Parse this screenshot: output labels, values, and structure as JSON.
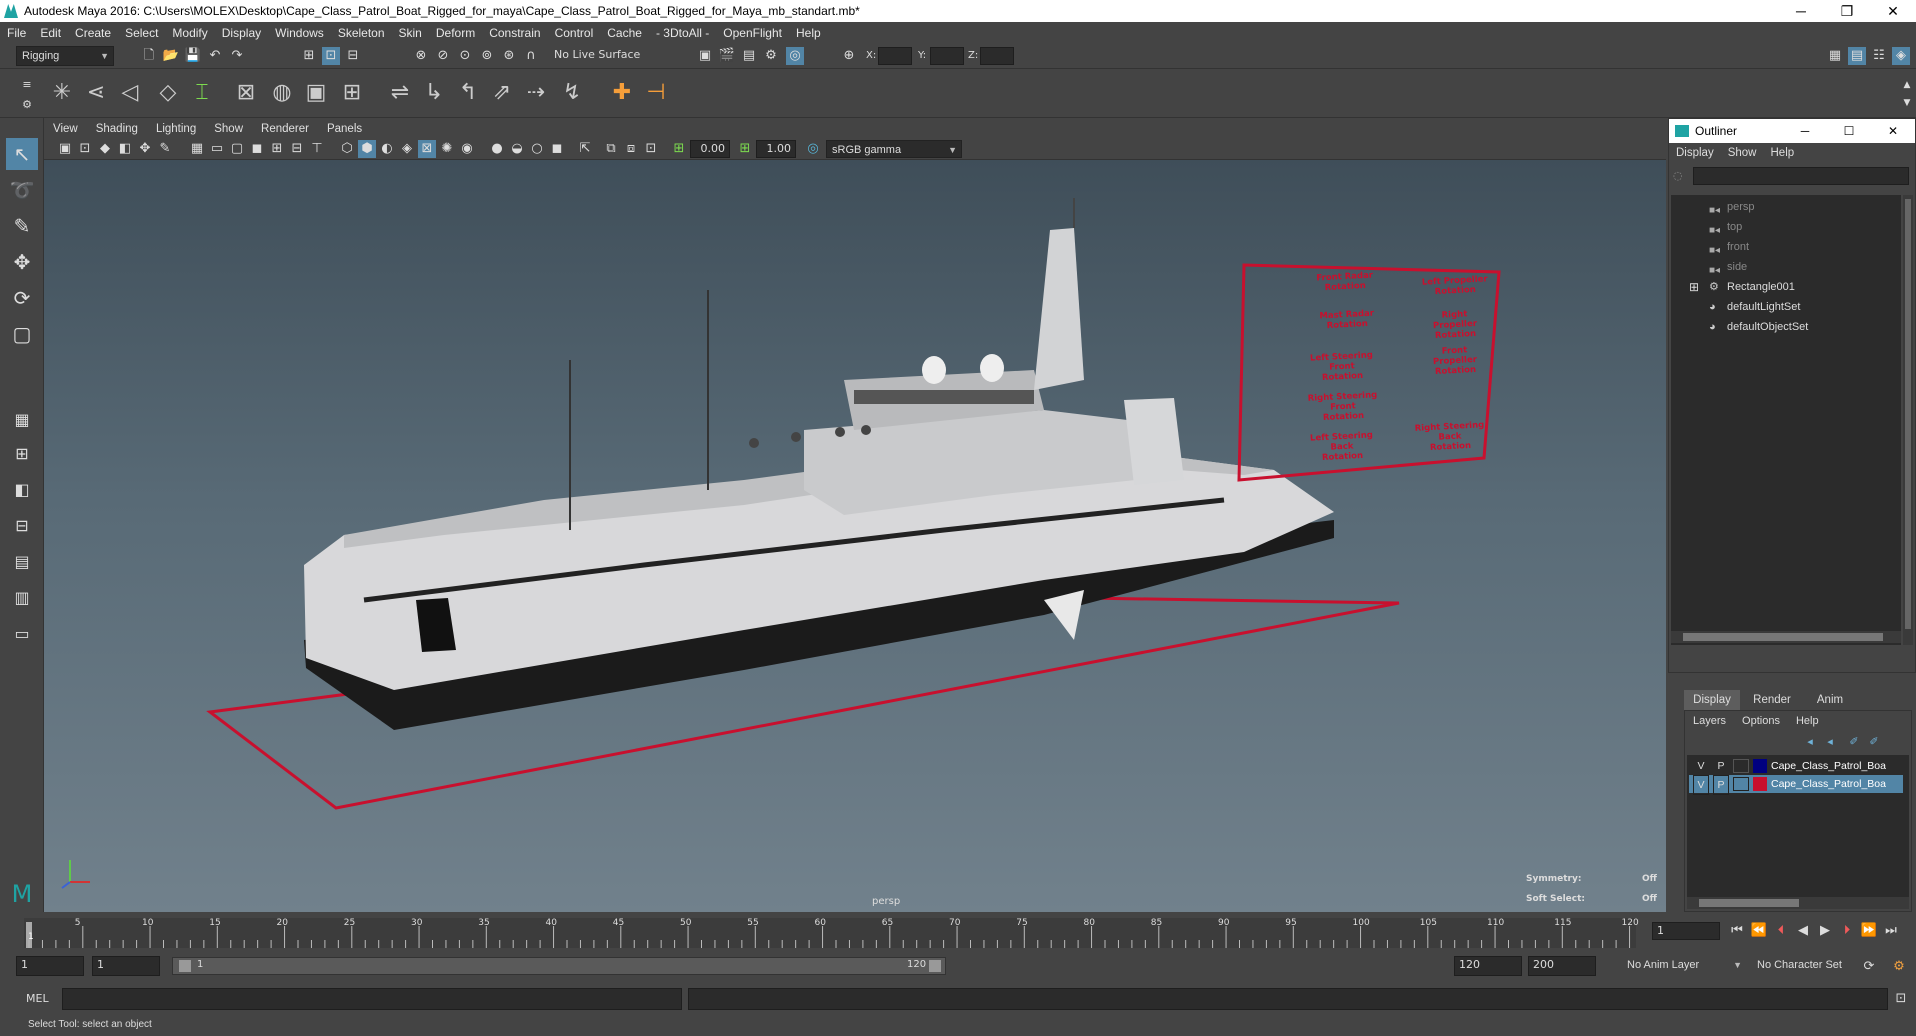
{
  "window": {
    "title": "Autodesk Maya 2016: C:\\Users\\MOLEX\\Desktop\\Cape_Class_Patrol_Boat_Rigged_for_maya\\Cape_Class_Patrol_Boat_Rigged_for_Maya_mb_standart.mb*",
    "min": "─",
    "max": "❐",
    "close": "✕"
  },
  "menubar": [
    "File",
    "Edit",
    "Create",
    "Select",
    "Modify",
    "Display",
    "Windows",
    "Skeleton",
    "Skin",
    "Deform",
    "Constrain",
    "Control",
    "Cache",
    "- 3DtoAll -",
    "OpenFlight",
    "Help"
  ],
  "statusline": {
    "mode": "Rigging",
    "live_surface": "No Live Surface",
    "x_label": "X:",
    "y_label": "Y:",
    "z_label": "Z:"
  },
  "viewport": {
    "menu": [
      "View",
      "Shading",
      "Lighting",
      "Show",
      "Renderer",
      "Panels"
    ],
    "exposure": "0.00",
    "gamma": "1.00",
    "colorspace": "sRGB gamma",
    "camera": "persp",
    "symmetry_label": "Symmetry:",
    "symmetry_value": "Off",
    "soft_label": "Soft Select:",
    "soft_value": "Off",
    "rig_labels": [
      [
        "Front Radar",
        "Rotation"
      ],
      [
        "Left Propeller",
        "Rotation"
      ],
      [
        "Mast Radar",
        "Rotation"
      ],
      [
        "Right Propeller",
        "Rotation"
      ],
      [
        "Left Steering Front",
        "Rotation"
      ],
      [
        "Front Propeller",
        "Rotation"
      ],
      [
        "Right Steering Front",
        "Rotation"
      ],
      [
        "Left Steering Back",
        "Rotation"
      ],
      [
        "Right Steering Back",
        "Rotation"
      ]
    ]
  },
  "outliner": {
    "title": "Outliner",
    "menu": [
      "Display",
      "Show",
      "Help"
    ],
    "items": [
      {
        "label": "persp",
        "dim": true
      },
      {
        "label": "top",
        "dim": true
      },
      {
        "label": "front",
        "dim": true
      },
      {
        "label": "side",
        "dim": true
      },
      {
        "label": "Rectangle001",
        "dim": false
      },
      {
        "label": "defaultLightSet",
        "dim": false
      },
      {
        "label": "defaultObjectSet",
        "dim": false
      }
    ]
  },
  "layers": {
    "tabs": [
      "Display",
      "Render",
      "Anim"
    ],
    "menu": [
      "Layers",
      "Options",
      "Help"
    ],
    "rows": [
      {
        "v": "V",
        "p": "P",
        "color": "#000080",
        "name": "Cape_Class_Patrol_Boa"
      },
      {
        "v": "V",
        "p": "P",
        "color": "#c8102e",
        "name": "Cape_Class_Patrol_Boa"
      }
    ]
  },
  "timeline": {
    "ticks": [
      "5",
      "10",
      "15",
      "20",
      "25",
      "30",
      "35",
      "40",
      "45",
      "50",
      "55",
      "60",
      "65",
      "70",
      "75",
      "80",
      "85",
      "90",
      "95",
      "100",
      "105",
      "110",
      "115",
      "120"
    ],
    "start_tick": "1",
    "current_frame": "1"
  },
  "range": {
    "start": "1",
    "start_inner": "1",
    "slider_start": "1",
    "slider_end": "120",
    "end": "120",
    "anim_end": "200",
    "anim_layer": "No Anim Layer",
    "char_set": "No Character Set"
  },
  "mel": {
    "label": "MEL"
  },
  "help": {
    "text": "Select Tool: select an object"
  },
  "colors": {
    "rig_red": "#c8102e",
    "bg": "#444444"
  }
}
